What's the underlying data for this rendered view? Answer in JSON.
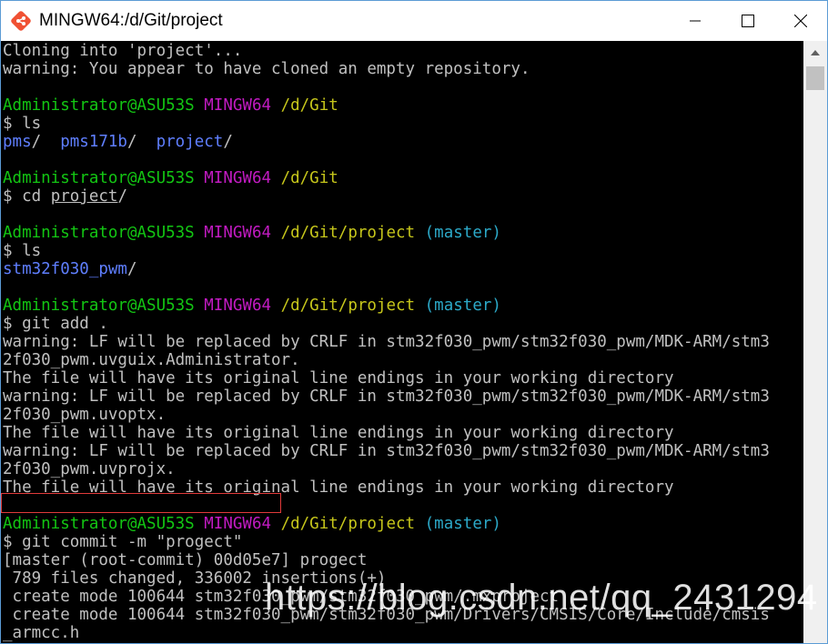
{
  "window": {
    "title": "MINGW64:/d/Git/project"
  },
  "terminal": {
    "lines": [
      [
        {
          "t": "Cloning into 'project'...",
          "c": "w"
        }
      ],
      [
        {
          "t": "warning: You appear to have cloned an empty repository.",
          "c": "w"
        }
      ],
      [],
      [
        {
          "t": "Administrator@ASU53S",
          "c": "g"
        },
        {
          "t": " ",
          "c": "w"
        },
        {
          "t": "MINGW64",
          "c": "m"
        },
        {
          "t": " ",
          "c": "w"
        },
        {
          "t": "/d/Git",
          "c": "y"
        }
      ],
      [
        {
          "t": "$ ls",
          "c": "w"
        }
      ],
      [
        {
          "t": "pms",
          "c": "b"
        },
        {
          "t": "/  ",
          "c": "w"
        },
        {
          "t": "pms171b",
          "c": "b"
        },
        {
          "t": "/  ",
          "c": "w"
        },
        {
          "t": "project",
          "c": "b"
        },
        {
          "t": "/",
          "c": "w"
        }
      ],
      [],
      [
        {
          "t": "Administrator@ASU53S",
          "c": "g"
        },
        {
          "t": " ",
          "c": "w"
        },
        {
          "t": "MINGW64",
          "c": "m"
        },
        {
          "t": " ",
          "c": "w"
        },
        {
          "t": "/d/Git",
          "c": "y"
        }
      ],
      [
        {
          "t": "$ cd ",
          "c": "w"
        },
        {
          "t": "project",
          "c": "w",
          "u": true
        },
        {
          "t": "/",
          "c": "w"
        }
      ],
      [],
      [
        {
          "t": "Administrator@ASU53S",
          "c": "g"
        },
        {
          "t": " ",
          "c": "w"
        },
        {
          "t": "MINGW64",
          "c": "m"
        },
        {
          "t": " ",
          "c": "w"
        },
        {
          "t": "/d/Git/project",
          "c": "y"
        },
        {
          "t": " ",
          "c": "w"
        },
        {
          "t": "(master)",
          "c": "c"
        }
      ],
      [
        {
          "t": "$ ls",
          "c": "w"
        }
      ],
      [
        {
          "t": "stm32f030_pwm",
          "c": "b"
        },
        {
          "t": "/",
          "c": "w"
        }
      ],
      [],
      [
        {
          "t": "Administrator@ASU53S",
          "c": "g"
        },
        {
          "t": " ",
          "c": "w"
        },
        {
          "t": "MINGW64",
          "c": "m"
        },
        {
          "t": " ",
          "c": "w"
        },
        {
          "t": "/d/Git/project",
          "c": "y"
        },
        {
          "t": " ",
          "c": "w"
        },
        {
          "t": "(master)",
          "c": "c"
        }
      ],
      [
        {
          "t": "$ git add .",
          "c": "w"
        }
      ],
      [
        {
          "t": "warning: LF will be replaced by CRLF in stm32f030_pwm/stm32f030_pwm/MDK-ARM/stm3",
          "c": "w"
        }
      ],
      [
        {
          "t": "2f030_pwm.uvguix.Administrator.",
          "c": "w"
        }
      ],
      [
        {
          "t": "The file will have its original line endings in your working directory",
          "c": "w"
        }
      ],
      [
        {
          "t": "warning: LF will be replaced by CRLF in stm32f030_pwm/stm32f030_pwm/MDK-ARM/stm3",
          "c": "w"
        }
      ],
      [
        {
          "t": "2f030_pwm.uvoptx.",
          "c": "w"
        }
      ],
      [
        {
          "t": "The file will have its original line endings in your working directory",
          "c": "w"
        }
      ],
      [
        {
          "t": "warning: LF will be replaced by CRLF in stm32f030_pwm/stm32f030_pwm/MDK-ARM/stm3",
          "c": "w"
        }
      ],
      [
        {
          "t": "2f030_pwm.uvprojx.",
          "c": "w"
        }
      ],
      [
        {
          "t": "The file will have its original line endings in your working directory",
          "c": "w"
        }
      ],
      [],
      [
        {
          "t": "Administrator@ASU53S",
          "c": "g"
        },
        {
          "t": " ",
          "c": "w"
        },
        {
          "t": "MINGW64",
          "c": "m"
        },
        {
          "t": " ",
          "c": "w"
        },
        {
          "t": "/d/Git/project",
          "c": "y"
        },
        {
          "t": " ",
          "c": "w"
        },
        {
          "t": "(master)",
          "c": "c"
        }
      ],
      [
        {
          "t": "$ git commit -m \"progect\"",
          "c": "w"
        }
      ],
      [
        {
          "t": "[master (root-commit) 00d05e7] progect",
          "c": "w"
        }
      ],
      [
        {
          "t": " 789 files changed, 336002 insertions(+)",
          "c": "w"
        }
      ],
      [
        {
          "t": " create mode 100644 stm32f030_pwm/stm32f030_pwm/.mxproject",
          "c": "w"
        }
      ],
      [
        {
          "t": " create mode 100644 stm32f030_pwm/stm32f030_pwm/Drivers/CMSIS/Core/Include/cmsis",
          "c": "w"
        }
      ],
      [
        {
          "t": "_armcc.h",
          "c": "w"
        }
      ]
    ]
  },
  "watermark": "https://blog.csdn.net/qq_2431294",
  "colors": {
    "prompt_user": "#13c613",
    "prompt_host": "#c21bc2",
    "prompt_path": "#c6c61b",
    "prompt_branch": "#2ca9c8",
    "directory": "#5f7fff",
    "text": "#c0c0c0",
    "highlight": "#e03a3a"
  }
}
